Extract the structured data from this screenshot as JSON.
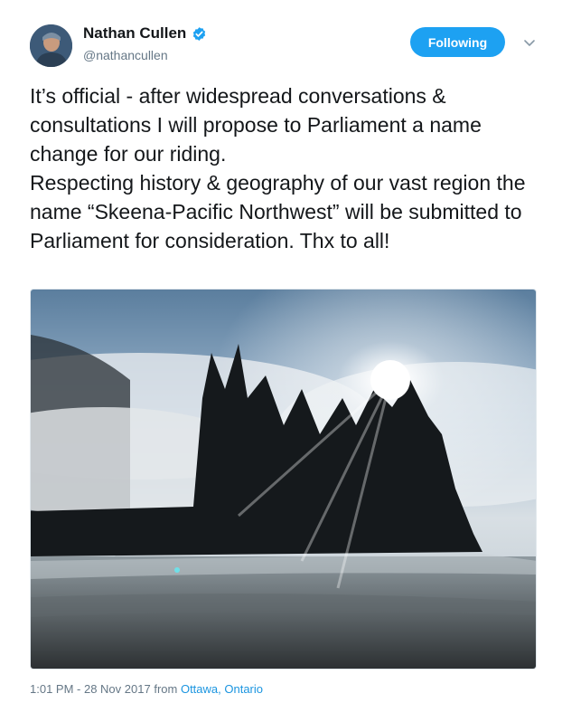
{
  "user": {
    "display_name": "Nathan Cullen",
    "handle": "@nathancullen"
  },
  "actions": {
    "follow_label": "Following"
  },
  "tweet": {
    "line1": "It’s official - after widespread conversations & consultations I will propose to Parliament a name change for our riding.",
    "line2": "Respecting history & geography of our vast region the name “Skeena-Pacific Northwest” will be submitted to Parliament for consideration.  Thx to all!"
  },
  "meta": {
    "timestamp": "1:01 PM - 28 Nov 2017",
    "from_word": "from",
    "location": "Ottawa, Ontario"
  },
  "colors": {
    "accent": "#1da1f2",
    "link": "#1b95e0",
    "secondary_text": "#657786"
  },
  "icons": {
    "verified": "verified-badge-icon",
    "menu": "chevron-down-icon"
  }
}
